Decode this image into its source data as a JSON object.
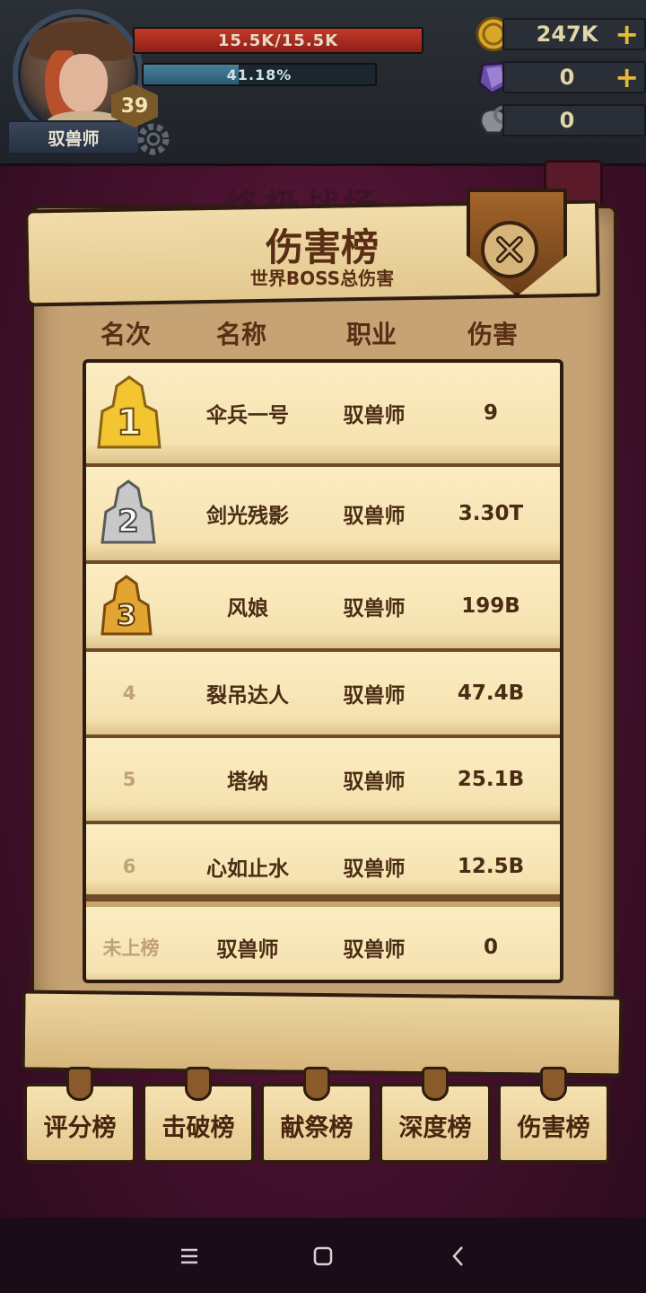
{
  "hud": {
    "player_name": "驭兽师",
    "level": "39",
    "hp_text": "15.5K/15.5K",
    "hp_fraction": 1.0,
    "exp_text": "41.18%",
    "exp_fraction": 0.4118,
    "gold": "247K",
    "gems": "0",
    "tokens": "0"
  },
  "background": {
    "title": "终极战场"
  },
  "panel": {
    "title": "伤害榜",
    "subtitle": "世界BOSS总伤害",
    "columns": [
      "名次",
      "名称",
      "职业",
      "伤害"
    ],
    "rows": [
      {
        "rank": "1",
        "name": "伞兵一号",
        "job": "驭兽师",
        "damage": "9"
      },
      {
        "rank": "2",
        "name": "剑光残影",
        "job": "驭兽师",
        "damage": "3.30T"
      },
      {
        "rank": "3",
        "name": "风娘",
        "job": "驭兽师",
        "damage": "199B"
      },
      {
        "rank": "4",
        "name": "裂吊达人",
        "job": "驭兽师",
        "damage": "47.4B"
      },
      {
        "rank": "5",
        "name": "塔纳",
        "job": "驭兽师",
        "damage": "25.1B"
      },
      {
        "rank": "6",
        "name": "心如止水",
        "job": "驭兽师",
        "damage": "12.5B"
      }
    ],
    "self_row": {
      "rank": "未上榜",
      "name": "驭兽师",
      "job": "驭兽师",
      "damage": "0"
    }
  },
  "tabs": [
    "评分榜",
    "击破榜",
    "献祭榜",
    "深度榜",
    "伤害榜"
  ],
  "colors": {
    "gold_badge": "#f2c531",
    "silver_badge": "#c8c8c8",
    "bronze_badge": "#e3a532"
  }
}
